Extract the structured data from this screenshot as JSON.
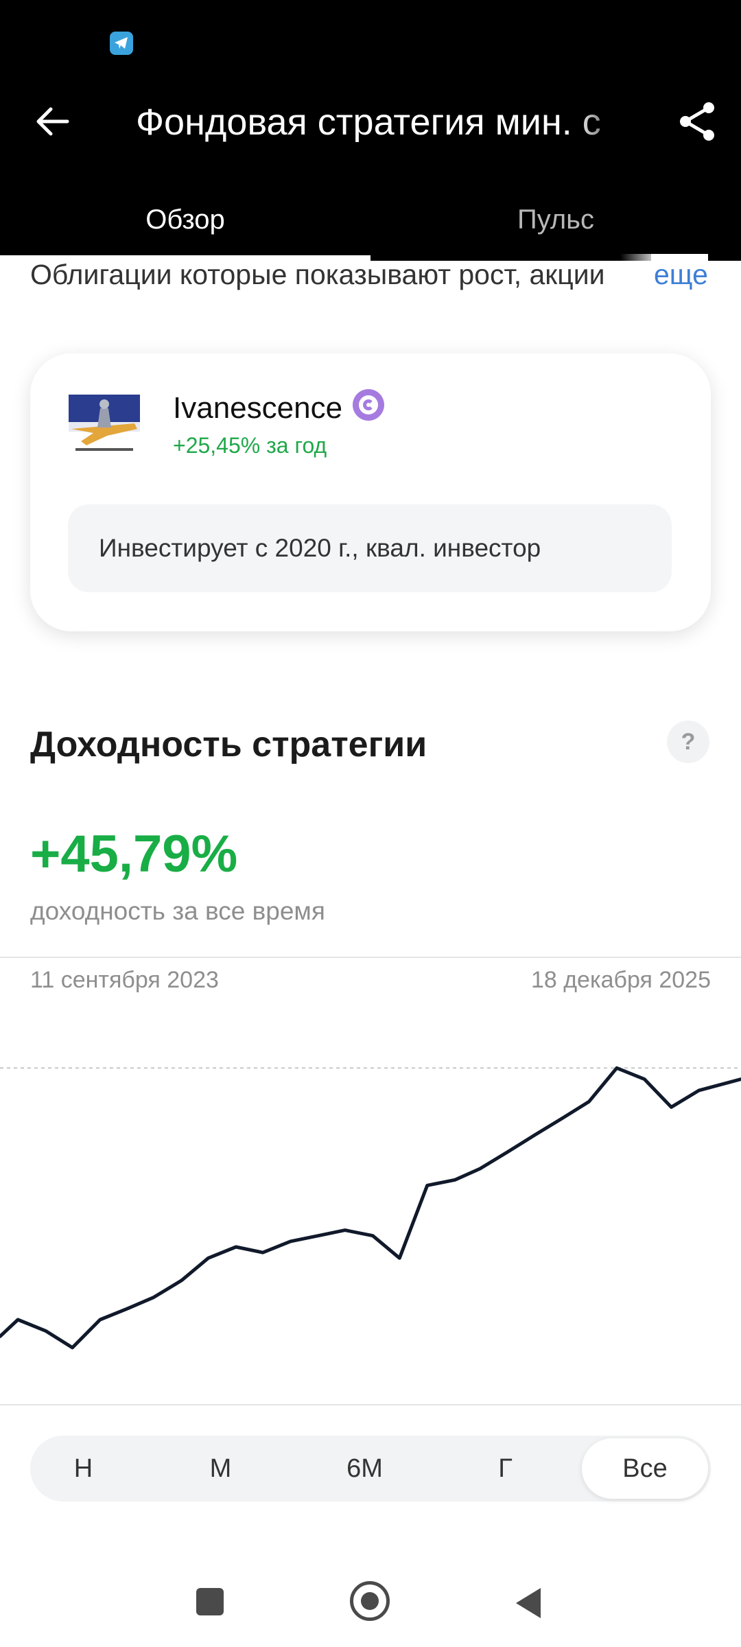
{
  "header": {
    "title": "Фондовая стратегия мин. с",
    "tabs": [
      {
        "label": "Обзор",
        "active": true
      },
      {
        "label": "Пульс",
        "active": false
      }
    ]
  },
  "description": {
    "text": "Облигации которые показывают рост, акции",
    "more_label": "еще"
  },
  "author": {
    "name": "Ivanescence",
    "return_text": "+25,45% за год",
    "info": "Инвестирует с 2020 г., квал. инвестор"
  },
  "yield_section": {
    "title": "Доходность стратегии",
    "help_label": "?",
    "total_return": "+45,79%",
    "caption": "доходность за все время",
    "date_start": "11 сентября 2023",
    "date_end": "18 декабря 2025"
  },
  "periods": [
    {
      "label": "Н",
      "active": false
    },
    {
      "label": "М",
      "active": false
    },
    {
      "label": "6М",
      "active": false
    },
    {
      "label": "Г",
      "active": false
    },
    {
      "label": "Все",
      "active": true
    }
  ],
  "colors": {
    "positive": "#19ad46",
    "link": "#3d7fd6",
    "line": "#111a2b"
  },
  "chart_data": {
    "type": "line",
    "x": [
      "2023-09-11",
      "2023-10-01",
      "2023-11-01",
      "2023-12-01",
      "2024-01-01",
      "2024-02-01",
      "2024-03-01",
      "2024-04-01",
      "2024-05-01",
      "2024-06-01",
      "2024-07-01",
      "2024-08-01",
      "2024-09-01",
      "2024-10-01",
      "2024-11-01",
      "2024-12-01",
      "2025-01-01",
      "2025-02-01",
      "2025-03-01",
      "2025-04-01",
      "2025-05-01",
      "2025-06-01",
      "2025-07-01",
      "2025-08-01",
      "2025-09-01",
      "2025-10-01",
      "2025-11-01",
      "2025-12-18"
    ],
    "series": [
      {
        "values": [
          0,
          3,
          1,
          -2,
          3,
          5,
          7,
          10,
          14,
          16,
          15,
          17,
          18,
          19,
          18,
          14,
          27,
          28,
          30,
          33,
          36,
          39,
          42,
          48,
          46,
          41,
          44,
          46
        ]
      }
    ],
    "xlabel": "",
    "ylabel": "",
    "ylim": [
      -4,
      50
    ],
    "grid": false
  }
}
